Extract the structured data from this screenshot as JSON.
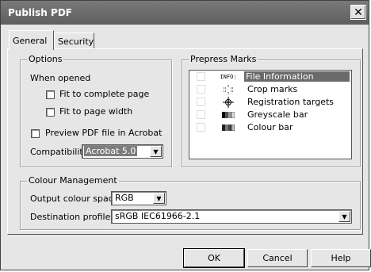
{
  "window": {
    "title": "Publish PDF",
    "close_glyph": "✕"
  },
  "tabs": [
    {
      "label": "General"
    },
    {
      "label": "Security"
    }
  ],
  "options": {
    "legend": "Options",
    "when_opened": "When opened",
    "fit_complete_page": "Fit to complete page",
    "fit_page_width": "Fit to page width",
    "preview_pdf": "Preview PDF file in Acrobat",
    "compatibility_label": "Compatibility:",
    "compatibility_value": "Acrobat 5.0"
  },
  "prepress": {
    "legend": "Prepress Marks",
    "items": [
      {
        "icon_text": "INFO:",
        "label": "File Information",
        "selected": true
      },
      {
        "icon_text": "",
        "label": "Crop marks"
      },
      {
        "icon_text": "",
        "label": "Registration targets"
      },
      {
        "icon_text": "",
        "label": "Greyscale bar"
      },
      {
        "icon_text": "",
        "label": "Colour bar"
      }
    ]
  },
  "colour": {
    "legend": "Colour Management",
    "output_label": "Output colour space:",
    "output_value": "RGB",
    "dest_label": "Destination profile:",
    "dest_value": "sRGB IEC61966-2.1"
  },
  "buttons": {
    "ok": "OK",
    "cancel": "Cancel",
    "help": "Help"
  }
}
